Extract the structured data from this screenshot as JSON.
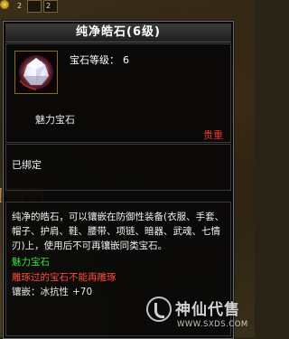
{
  "hud": {
    "slot_counts": [
      "2",
      "2"
    ]
  },
  "tooltip": {
    "title": "纯净皓石(6级)",
    "gem_level_label": "宝石等级：",
    "gem_level_value": "6",
    "gem_subtitle": "魅力宝石",
    "grade": "贵重",
    "bind_status": "已绑定",
    "description": "纯净的皓石，可以镶嵌在防御性装备(衣服、手套、帽子、护肩、鞋、腰带、项链、暗器、武魂、七情刃)上，使用后不可再镶嵌同类宝石。",
    "type_line": "魅力宝石",
    "warning_line": "雕琢过的宝石不能再雕琢",
    "inlay_label": "镶嵌：冰抗性",
    "inlay_value": "+70"
  },
  "watermark": {
    "name": "神仙代售",
    "url": "WWW.SXDS.COM"
  },
  "colors": {
    "panel_bg": "#080808",
    "green_text": "#37e03a",
    "red_text": "#ff4a3a",
    "grade_red": "#e83a2a"
  }
}
